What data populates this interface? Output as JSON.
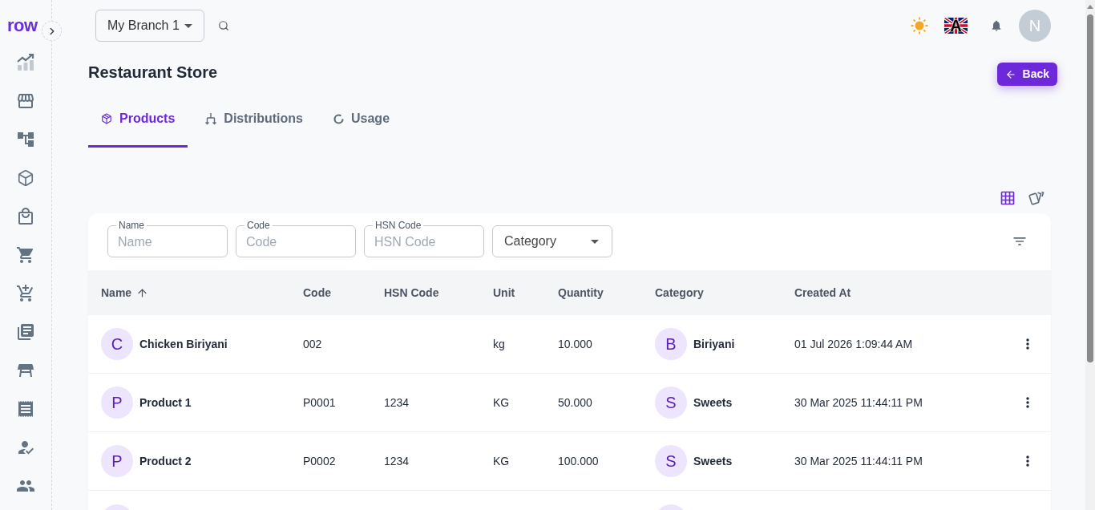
{
  "sidebar": {
    "logo": "row"
  },
  "top_bar": {
    "branch_select": {
      "value": "My Branch 1"
    },
    "language": {
      "flag_letter": "A"
    },
    "user_avatar": "N"
  },
  "page": {
    "title": "Restaurant Store",
    "back_button": "Back"
  },
  "tabs": [
    {
      "label": "Products",
      "selected": true
    },
    {
      "label": "Distributions",
      "selected": false
    },
    {
      "label": "Usage",
      "selected": false
    }
  ],
  "view_modes": [
    {
      "selected": true
    },
    {
      "selected": false
    }
  ],
  "filters": [
    {
      "kind": "text",
      "label": "Name",
      "placeholder": "Name"
    },
    {
      "kind": "text",
      "label": "Code",
      "placeholder": "Code"
    },
    {
      "kind": "text",
      "label": "HSN Code",
      "placeholder": "HSN Code"
    },
    {
      "kind": "select",
      "placeholder": "Category"
    }
  ],
  "table": {
    "columns": [
      {
        "label": "Name",
        "sorted_ascending": true
      },
      {
        "label": "Code"
      },
      {
        "label": "HSN Code"
      },
      {
        "label": "Unit"
      },
      {
        "label": "Quantity"
      },
      {
        "label": "Category"
      },
      {
        "label": "Created At"
      }
    ],
    "rows": [
      {
        "kind": "full",
        "avatar": "C",
        "name": "Chicken Biriyani",
        "code": "002",
        "unit": "kg",
        "quantity": "10.000",
        "category_avatar": "B",
        "category": "Biriyani",
        "created_at": "01 Jul 2026 1:09:44 AM"
      },
      {
        "kind": "full",
        "avatar": "P",
        "name": "Product 1",
        "code": "P0001",
        "hsn_code": "1234",
        "unit": "KG",
        "quantity": "50.000",
        "category_avatar": "S",
        "category": "Sweets",
        "created_at": "30 Mar 2025 11:44:11 PM"
      },
      {
        "kind": "full",
        "avatar": "P",
        "name": "Product 2",
        "code": "P0002",
        "hsn_code": "1234",
        "unit": "KG",
        "quantity": "100.000",
        "category_avatar": "S",
        "category": "Sweets",
        "created_at": "30 Mar 2025 11:44:11 PM"
      },
      {
        "kind": "cut"
      }
    ]
  }
}
